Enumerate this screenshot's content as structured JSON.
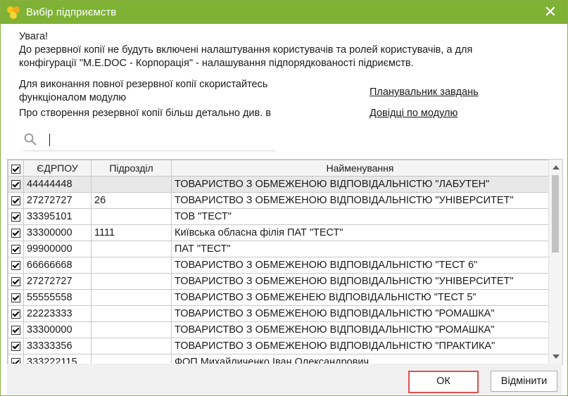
{
  "window": {
    "title": "Вибір підприємств",
    "close_glyph": "✕"
  },
  "warning": {
    "line1": "Увага!",
    "line2": "До резервної копії не будуть включені налаштування користувачів та ролей користувачів, а для",
    "line3": "конфігурації \"M.E.DOC - Корпорація\" - налашування підпорядкованості підриємств."
  },
  "info": {
    "line1": "Для виконання повної резервної копії скористайтесь",
    "line2": "функціоналом модулю",
    "line3": "Про створення резервної копії більш детально див. в"
  },
  "links": {
    "scheduler": "Планувальник завдань",
    "help": "Довідці по модулю"
  },
  "search": {
    "value": ""
  },
  "table": {
    "headers": {
      "code": "ЄДРПОУ",
      "division": "Підрозділ",
      "name": "Найменування"
    },
    "rows": [
      {
        "code": "44444448",
        "division": "",
        "name": "ТОВАРИСТВО З ОБМЕЖЕНОЮ ВІДПОВІДАЛЬНІСТЮ \"ЛАБУТЕН\""
      },
      {
        "code": "27272727",
        "division": "26",
        "name": "ТОВАРИСТВО З ОБМЕЖЕНОЮ ВІДПОВІДАЛЬНІСТЮ \"УНІВЕРСИТЕТ\""
      },
      {
        "code": "33395101",
        "division": "",
        "name": "ТОВ \"ТЕСТ\""
      },
      {
        "code": "33300000",
        "division": "1111",
        "name": "Київська обласна філія ПАТ \"ТЕСТ\""
      },
      {
        "code": "99900000",
        "division": "",
        "name": "ПАТ \"ТЕСТ\""
      },
      {
        "code": "66666668",
        "division": "",
        "name": "ТОВАРИСТВО З ОБМЕЖЕНОЮ ВІДПОВІДАЛЬНІСТЮ \"ТЕСТ 6\""
      },
      {
        "code": "27272727",
        "division": "",
        "name": "ТОВАРИСТВО З ОБМЕЖЕНОЮ ВІДПОВІДАЛЬНІСТЮ \"УНІВЕРСИТЕТ\""
      },
      {
        "code": "55555558",
        "division": "",
        "name": "ТОВАРИСТВО З ОБМЕЖЕНЕЮ ВІДПОВІДАЛЬНІСТЮ \"ТЕСТ 5\""
      },
      {
        "code": "22223333",
        "division": "",
        "name": "ТОВАРИСТВО З ОБМЕЖЕНОЮ ВІДПОВІДАЛЬНІСТЮ \"РОМАШКА\""
      },
      {
        "code": "33300000",
        "division": "",
        "name": "ТОВАРИСТВО З ОБМЕЖЕНОЮ ВІДПОВІДАЛЬНІСТЮ \"РОМАШКА\""
      },
      {
        "code": "33333356",
        "division": "",
        "name": "ТОВАРИСТВО З ОБМЕЖЕНОЮ ВІДПОВІДАЛЬНІСТЮ \"ПРАКТИКА\""
      },
      {
        "code": "333222115",
        "division": "",
        "name": "ФОП Михайличенко Іван Олександрович"
      }
    ]
  },
  "buttons": {
    "ok": "ОК",
    "cancel": "Відмінити"
  },
  "colors": {
    "titlebar": "#7fb234",
    "ok_highlight": "#e05050"
  }
}
